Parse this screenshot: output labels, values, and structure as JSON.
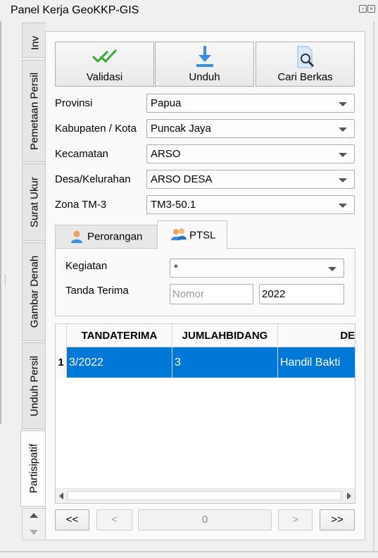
{
  "window": {
    "title": "Panel Kerja GeoKKP-GIS"
  },
  "side_tabs": [
    {
      "label": "Inv"
    },
    {
      "label": "Pemetaan Persil"
    },
    {
      "label": "Surat Ukur"
    },
    {
      "label": "Gambar Denah"
    },
    {
      "label": "Unduh Persil"
    },
    {
      "label": "Partisipatif"
    }
  ],
  "toolbar": {
    "validasi": "Validasi",
    "unduh": "Unduh",
    "cari_berkas": "Cari Berkas"
  },
  "form": {
    "provinsi": {
      "label": "Provinsi",
      "value": "Papua"
    },
    "kabupaten": {
      "label": "Kabupaten / Kota",
      "value": "Puncak Jaya"
    },
    "kecamatan": {
      "label": "Kecamatan",
      "value": "ARSO"
    },
    "desa": {
      "label": "Desa/Kelurahan",
      "value": "ARSO DESA"
    },
    "zona": {
      "label": "Zona TM-3",
      "value": "TM3-50.1"
    }
  },
  "tabs": [
    {
      "label": "Perorangan",
      "active": false
    },
    {
      "label": "PTSL",
      "active": true
    }
  ],
  "ptsl": {
    "kegiatan_label": "Kegiatan",
    "kegiatan_value": "*",
    "tanda_terima_label": "Tanda Terima",
    "nomor_placeholder": "Nomor",
    "tahun_value": "2022"
  },
  "table": {
    "columns": [
      "TANDATERIMA",
      "JUMLAHBIDANG",
      "DESA"
    ],
    "rows": [
      {
        "index": "1",
        "cells": [
          "3/2022",
          "3",
          "Handil Bakti"
        ]
      }
    ]
  },
  "pagination": {
    "first": "<<",
    "prev": "<",
    "page": "0",
    "next": ">",
    "last": ">>"
  },
  "colors": {
    "selection": "#0078d7",
    "accent_icon": "#3a8ee6"
  }
}
